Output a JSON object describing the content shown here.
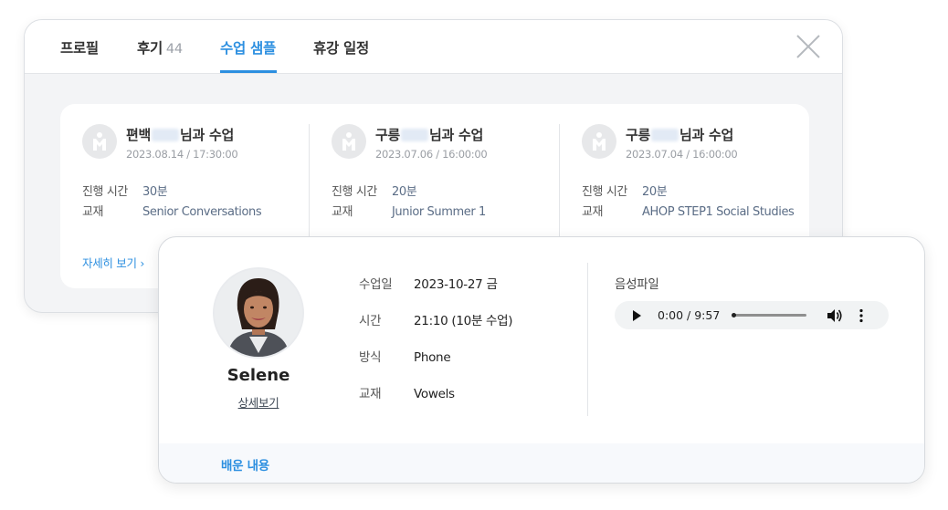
{
  "tabs": [
    {
      "label": "프로필",
      "count": ""
    },
    {
      "label": "후기",
      "count": "44"
    },
    {
      "label": "수업 샘플",
      "count": ""
    },
    {
      "label": "휴강 일정",
      "count": ""
    }
  ],
  "active_tab": "수업 샘플",
  "lessons": [
    {
      "title_prefix": "편백",
      "title_suffix": "님과 수업",
      "datetime": "2023.08.14 / 17:30:00",
      "duration_label": "진행 시간",
      "duration": "30분",
      "material_label": "교재",
      "material": "Senior Conversations"
    },
    {
      "title_prefix": "구릉",
      "title_suffix": "님과 수업",
      "datetime": "2023.07.06 / 16:00:00",
      "duration_label": "진행 시간",
      "duration": "20분",
      "material_label": "교재",
      "material": "Junior Summer 1"
    },
    {
      "title_prefix": "구릉",
      "title_suffix": "님과 수업",
      "datetime": "2023.07.04 / 16:00:00",
      "duration_label": "진행 시간",
      "duration": "20분",
      "material_label": "교재",
      "material": "AHOP STEP1 Social Studies"
    }
  ],
  "lesson_detail_link": "자세히 보기",
  "detail": {
    "tutor_name": "Selene",
    "tutor_link": "상세보기",
    "rows": [
      {
        "label": "수업일",
        "value": "2023-10-27 금"
      },
      {
        "label": "시간",
        "value": "21:10 (10분 수업)"
      },
      {
        "label": "방식",
        "value": "Phone"
      },
      {
        "label": "교재",
        "value": "Vowels"
      }
    ],
    "audio_label": "음성파일",
    "audio_time": "0:00 / 9:57",
    "audio_progress": 0,
    "learned_tab": "배운 내용"
  },
  "colors": {
    "accent": "#2c8fe0",
    "muted_value": "#5b6d86"
  }
}
